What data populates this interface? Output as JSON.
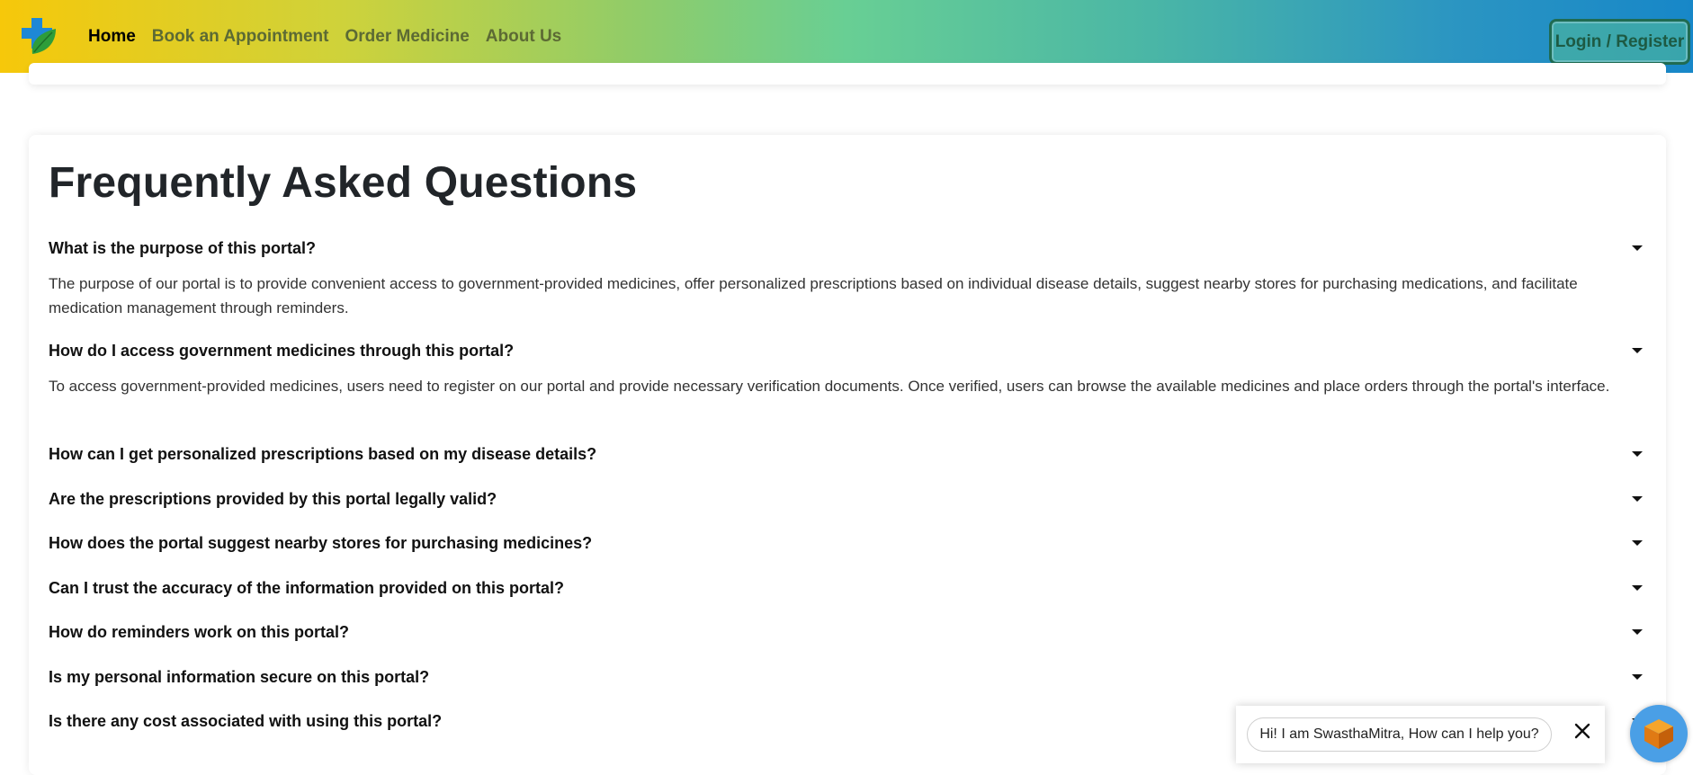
{
  "nav": {
    "links": [
      "Home",
      "Book an Appointment",
      "Order Medicine",
      "About Us"
    ],
    "login_label": "Login / Register"
  },
  "faq": {
    "title": "Frequently Asked Questions",
    "items": [
      {
        "q": "What is the purpose of this portal?",
        "a": "The purpose of our portal is to provide convenient access to government-provided medicines, offer personalized prescriptions based on individual disease details, suggest nearby stores for purchasing medications, and facilitate medication management through reminders."
      },
      {
        "q": "How do I access government medicines through this portal?",
        "a": "To access government-provided medicines, users need to register on our portal and provide necessary verification documents. Once verified, users can browse the available medicines and place orders through the portal's interface."
      },
      {
        "q": "How can I get personalized prescriptions based on my disease details?"
      },
      {
        "q": "Are the prescriptions provided by this portal legally valid?"
      },
      {
        "q": "How does the portal suggest nearby stores for purchasing medicines?"
      },
      {
        "q": "Can I trust the accuracy of the information provided on this portal?"
      },
      {
        "q": "How do reminders work on this portal?"
      },
      {
        "q": "Is my personal information secure on this portal?"
      },
      {
        "q": "Is there any cost associated with using this portal?"
      }
    ]
  },
  "chat": {
    "greeting": "Hi! I am SwasthaMitra, How can I help you?"
  },
  "icons": {
    "logo": "medical-cross-leaf-icon",
    "caret": "caret-down-icon",
    "close": "close-icon",
    "bot": "chatbot-cube-icon"
  },
  "colors": {
    "nav_active": "#000000",
    "nav_link": "#5c6a34",
    "login_border": "#1f6b52"
  }
}
